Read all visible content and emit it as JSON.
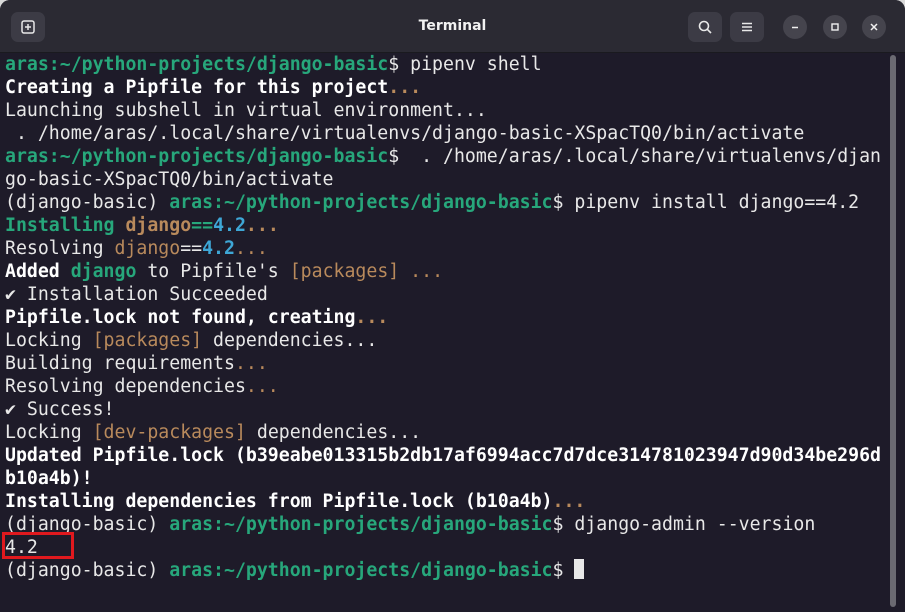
{
  "window": {
    "title": "Terminal",
    "icons": {
      "new_tab": "new-tab-icon",
      "search": "search-icon",
      "menu": "hamburger-menu-icon",
      "minimize": "minimize-icon",
      "maximize": "maximize-icon",
      "close": "close-icon"
    }
  },
  "terminal": {
    "lines": [
      [
        {
          "t": "aras:~/python-projects/django-basic",
          "s": "g"
        },
        {
          "t": "$ pipenv shell",
          "s": ""
        }
      ],
      [
        {
          "t": "Creating a Pipfile for this project",
          "s": "b"
        },
        {
          "t": "...",
          "s": "bo"
        }
      ],
      [
        {
          "t": "Launching subshell in virtual environment...",
          "s": ""
        }
      ],
      [
        {
          "t": " . /home/aras/.local/share/virtualenvs/django-basic-XSpacTQ0/bin/activate",
          "s": ""
        }
      ],
      [
        {
          "t": "aras:~/python-projects/django-basic",
          "s": "g"
        },
        {
          "t": "$  . /home/aras/.local/share/virtualenvs/djan",
          "s": ""
        }
      ],
      [
        {
          "t": "go-basic-XSpacTQ0/bin/activate",
          "s": ""
        }
      ],
      [
        {
          "t": "(django-basic) ",
          "s": ""
        },
        {
          "t": "aras:~/python-projects/django-basic",
          "s": "g"
        },
        {
          "t": "$ pipenv install django==4.2",
          "s": ""
        }
      ],
      [
        {
          "t": "Installing ",
          "s": "g"
        },
        {
          "t": "django",
          "s": "bo"
        },
        {
          "t": "==",
          "s": "g"
        },
        {
          "t": "4.2",
          "s": "c"
        },
        {
          "t": "...",
          "s": "bo"
        }
      ],
      [
        {
          "t": "Resolving ",
          "s": ""
        },
        {
          "t": "django",
          "s": "o"
        },
        {
          "t": "==",
          "s": ""
        },
        {
          "t": "4.2",
          "s": "c"
        },
        {
          "t": "...",
          "s": "o"
        }
      ],
      [
        {
          "t": "Added ",
          "s": "b"
        },
        {
          "t": "django",
          "s": "g"
        },
        {
          "t": " to Pipfile's ",
          "s": ""
        },
        {
          "t": "[packages]",
          "s": "o"
        },
        {
          "t": " ...",
          "s": "o"
        }
      ],
      [
        {
          "t": "✔ Installation Succeeded",
          "s": ""
        }
      ],
      [
        {
          "t": "Pipfile.lock not found, creating",
          "s": "b"
        },
        {
          "t": "...",
          "s": "bo"
        }
      ],
      [
        {
          "t": "Locking ",
          "s": ""
        },
        {
          "t": "[packages]",
          "s": "o"
        },
        {
          "t": " dependencies...",
          "s": ""
        }
      ],
      [
        {
          "t": "Building requirements",
          "s": ""
        },
        {
          "t": "...",
          "s": "o"
        }
      ],
      [
        {
          "t": "Resolving dependencies",
          "s": ""
        },
        {
          "t": "...",
          "s": "o"
        }
      ],
      [
        {
          "t": "✔ Success!",
          "s": ""
        }
      ],
      [
        {
          "t": "Locking ",
          "s": ""
        },
        {
          "t": "[dev-packages]",
          "s": "o"
        },
        {
          "t": " dependencies...",
          "s": ""
        }
      ],
      [
        {
          "t": "Updated Pipfile.lock (b39eabe013315b2db17af6994acc7d7dce314781023947d90d34be296d",
          "s": "b"
        }
      ],
      [
        {
          "t": "b10a4b)!",
          "s": "b"
        }
      ],
      [
        {
          "t": "Installing dependencies from Pipfile.lock (b10a4b)",
          "s": "b"
        },
        {
          "t": "...",
          "s": "bo"
        }
      ],
      [
        {
          "t": "(django-basic) ",
          "s": ""
        },
        {
          "t": "aras:~/python-projects/django-basic",
          "s": "g"
        },
        {
          "t": "$ django-admin --version",
          "s": ""
        }
      ],
      [
        {
          "t": "4.2",
          "s": ""
        }
      ],
      [
        {
          "t": "(django-basic) ",
          "s": ""
        },
        {
          "t": "aras:~/python-projects/django-basic",
          "s": "g"
        },
        {
          "t": "$ ",
          "s": ""
        }
      ]
    ],
    "cursor_line": 22
  },
  "colors": {
    "prompt_green": "#27a77b",
    "orange": "#b98a5c",
    "cyan": "#3ea7d6",
    "highlight_red": "#e0191e",
    "background": "#1e1b29"
  }
}
